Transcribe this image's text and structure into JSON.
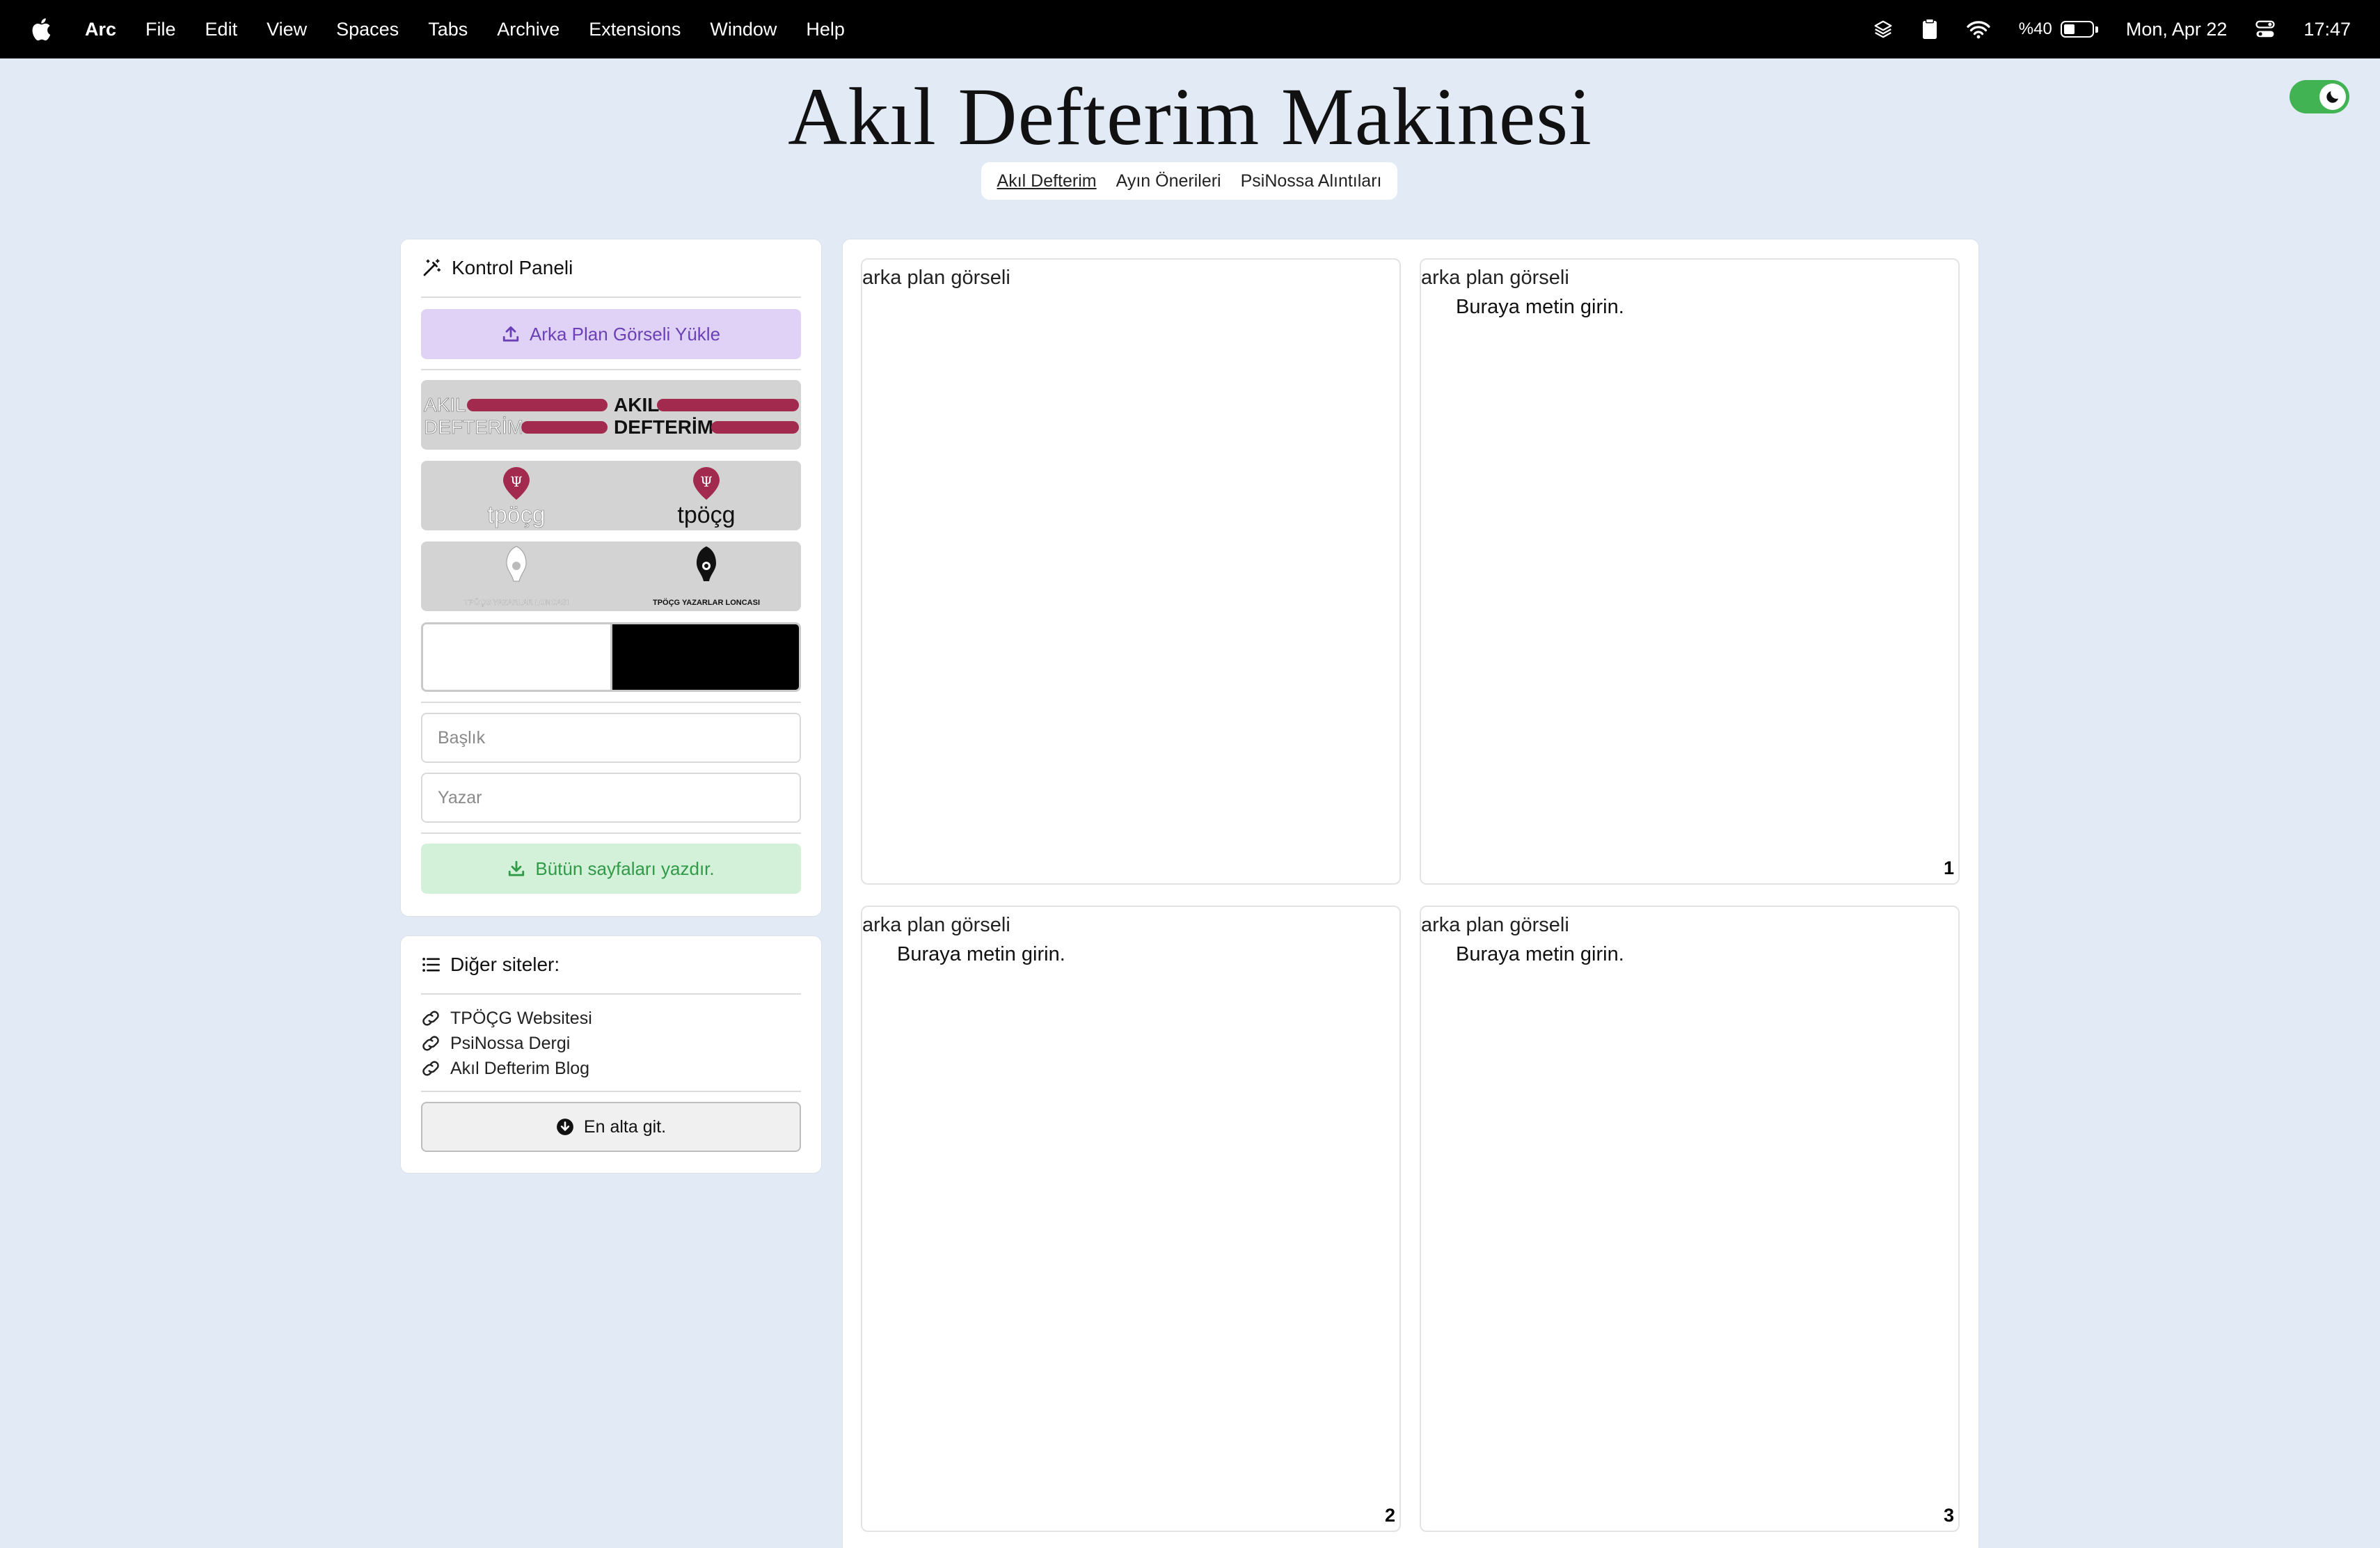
{
  "menubar": {
    "app": "Arc",
    "items": [
      "File",
      "Edit",
      "View",
      "Spaces",
      "Tabs",
      "Archive",
      "Extensions",
      "Window",
      "Help"
    ],
    "battery_pct": "%40",
    "battery_level": 0.4,
    "date": "Mon, Apr 22",
    "time": "17:47"
  },
  "header": {
    "title": "Akıl Defterim Makinesi",
    "nav": [
      "Akıl Defterim",
      "Ayın Önerileri",
      "PsiNossa Alıntıları"
    ]
  },
  "control_panel": {
    "title": "Kontrol Paneli",
    "upload_label": "Arka Plan Görseli Yükle",
    "title_placeholder": "Başlık",
    "author_placeholder": "Yazar",
    "print_label": "Bütün sayfaları yazdır.",
    "logos": {
      "akil_line1": "AKIL",
      "akil_line2": "DEFTERİM",
      "tpocg": "tpöçg",
      "yazarlar": "TPÖÇG YAZARLAR LONCASI"
    }
  },
  "other_sites": {
    "title": "Diğer siteler:",
    "links": [
      "TPÖÇG Websitesi",
      "PsiNossa Dergi",
      "Akıl Defterim Blog"
    ],
    "bottom_label": "En alta git."
  },
  "preview": {
    "image_alt": "arka plan görseli",
    "placeholder_text": "Buraya metin girin.",
    "pages": [
      {
        "number": "",
        "text": ""
      },
      {
        "number": "1",
        "text": "Buraya metin girin."
      },
      {
        "number": "2",
        "text": "Buraya metin girin."
      },
      {
        "number": "3",
        "text": "Buraya metin girin."
      }
    ]
  },
  "colors": {
    "background": "#e1eaf5",
    "upload_bg": "#e0d2f7",
    "print_bg": "#d3f1d9",
    "brand_red": "#a32a4f",
    "toggle_green": "#41b352"
  }
}
